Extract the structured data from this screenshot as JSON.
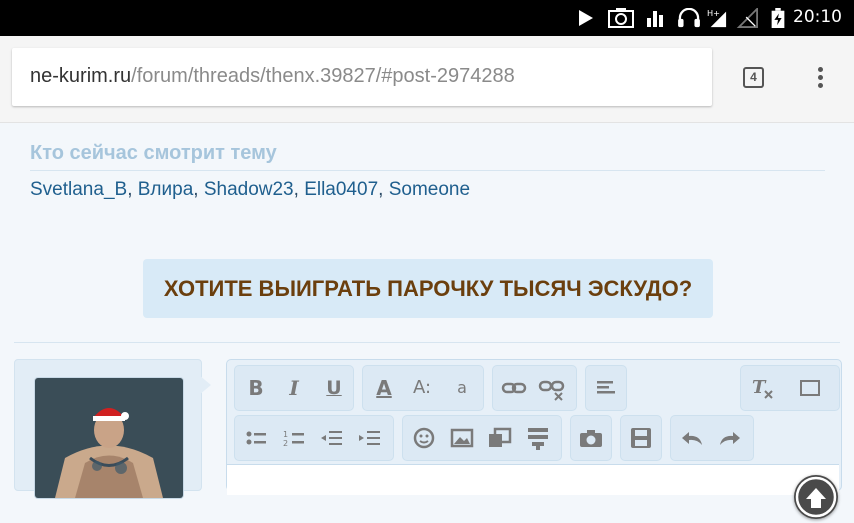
{
  "status_bar": {
    "time": "20:10",
    "icons": [
      "play-icon",
      "screenshot-icon",
      "sound-bars-icon",
      "headphones-icon",
      "signal-h-plus-icon",
      "no-signal-icon",
      "battery-charging-icon"
    ]
  },
  "browser": {
    "url_host": "ne-kurim.ru",
    "url_path": "/forum/threads/thenx.39827/#post-2974288",
    "tab_count": "4"
  },
  "who_viewing": {
    "title": "Кто сейчас смотрит тему",
    "users": [
      "Svetlana_B",
      "Влира",
      "Shadow23",
      "Ella0407",
      "Someone"
    ],
    "separator": ", "
  },
  "banner": {
    "text": "ХОТИТЕ ВЫИГРАТЬ ПАРОЧКУ ТЫСЯЧ ЭСКУДО?"
  },
  "editor": {
    "row1": [
      "bold-icon",
      "italic-icon",
      "underline-icon",
      "font-color-icon",
      "font-size-icon",
      "font-family-icon",
      "link-icon",
      "unlink-icon",
      "align-icon",
      "remove-format-icon"
    ],
    "row2": [
      "bullet-list-icon",
      "numbered-list-icon",
      "outdent-icon",
      "indent-icon",
      "smiley-icon",
      "image-icon",
      "media-icon",
      "quote-icon",
      "camera-icon",
      "save-icon",
      "undo-icon",
      "redo-icon"
    ],
    "labels": {
      "bold": "B",
      "italic": "I",
      "underline": "U",
      "font_color": "A",
      "font_size": "A:",
      "font_family": "a"
    }
  }
}
